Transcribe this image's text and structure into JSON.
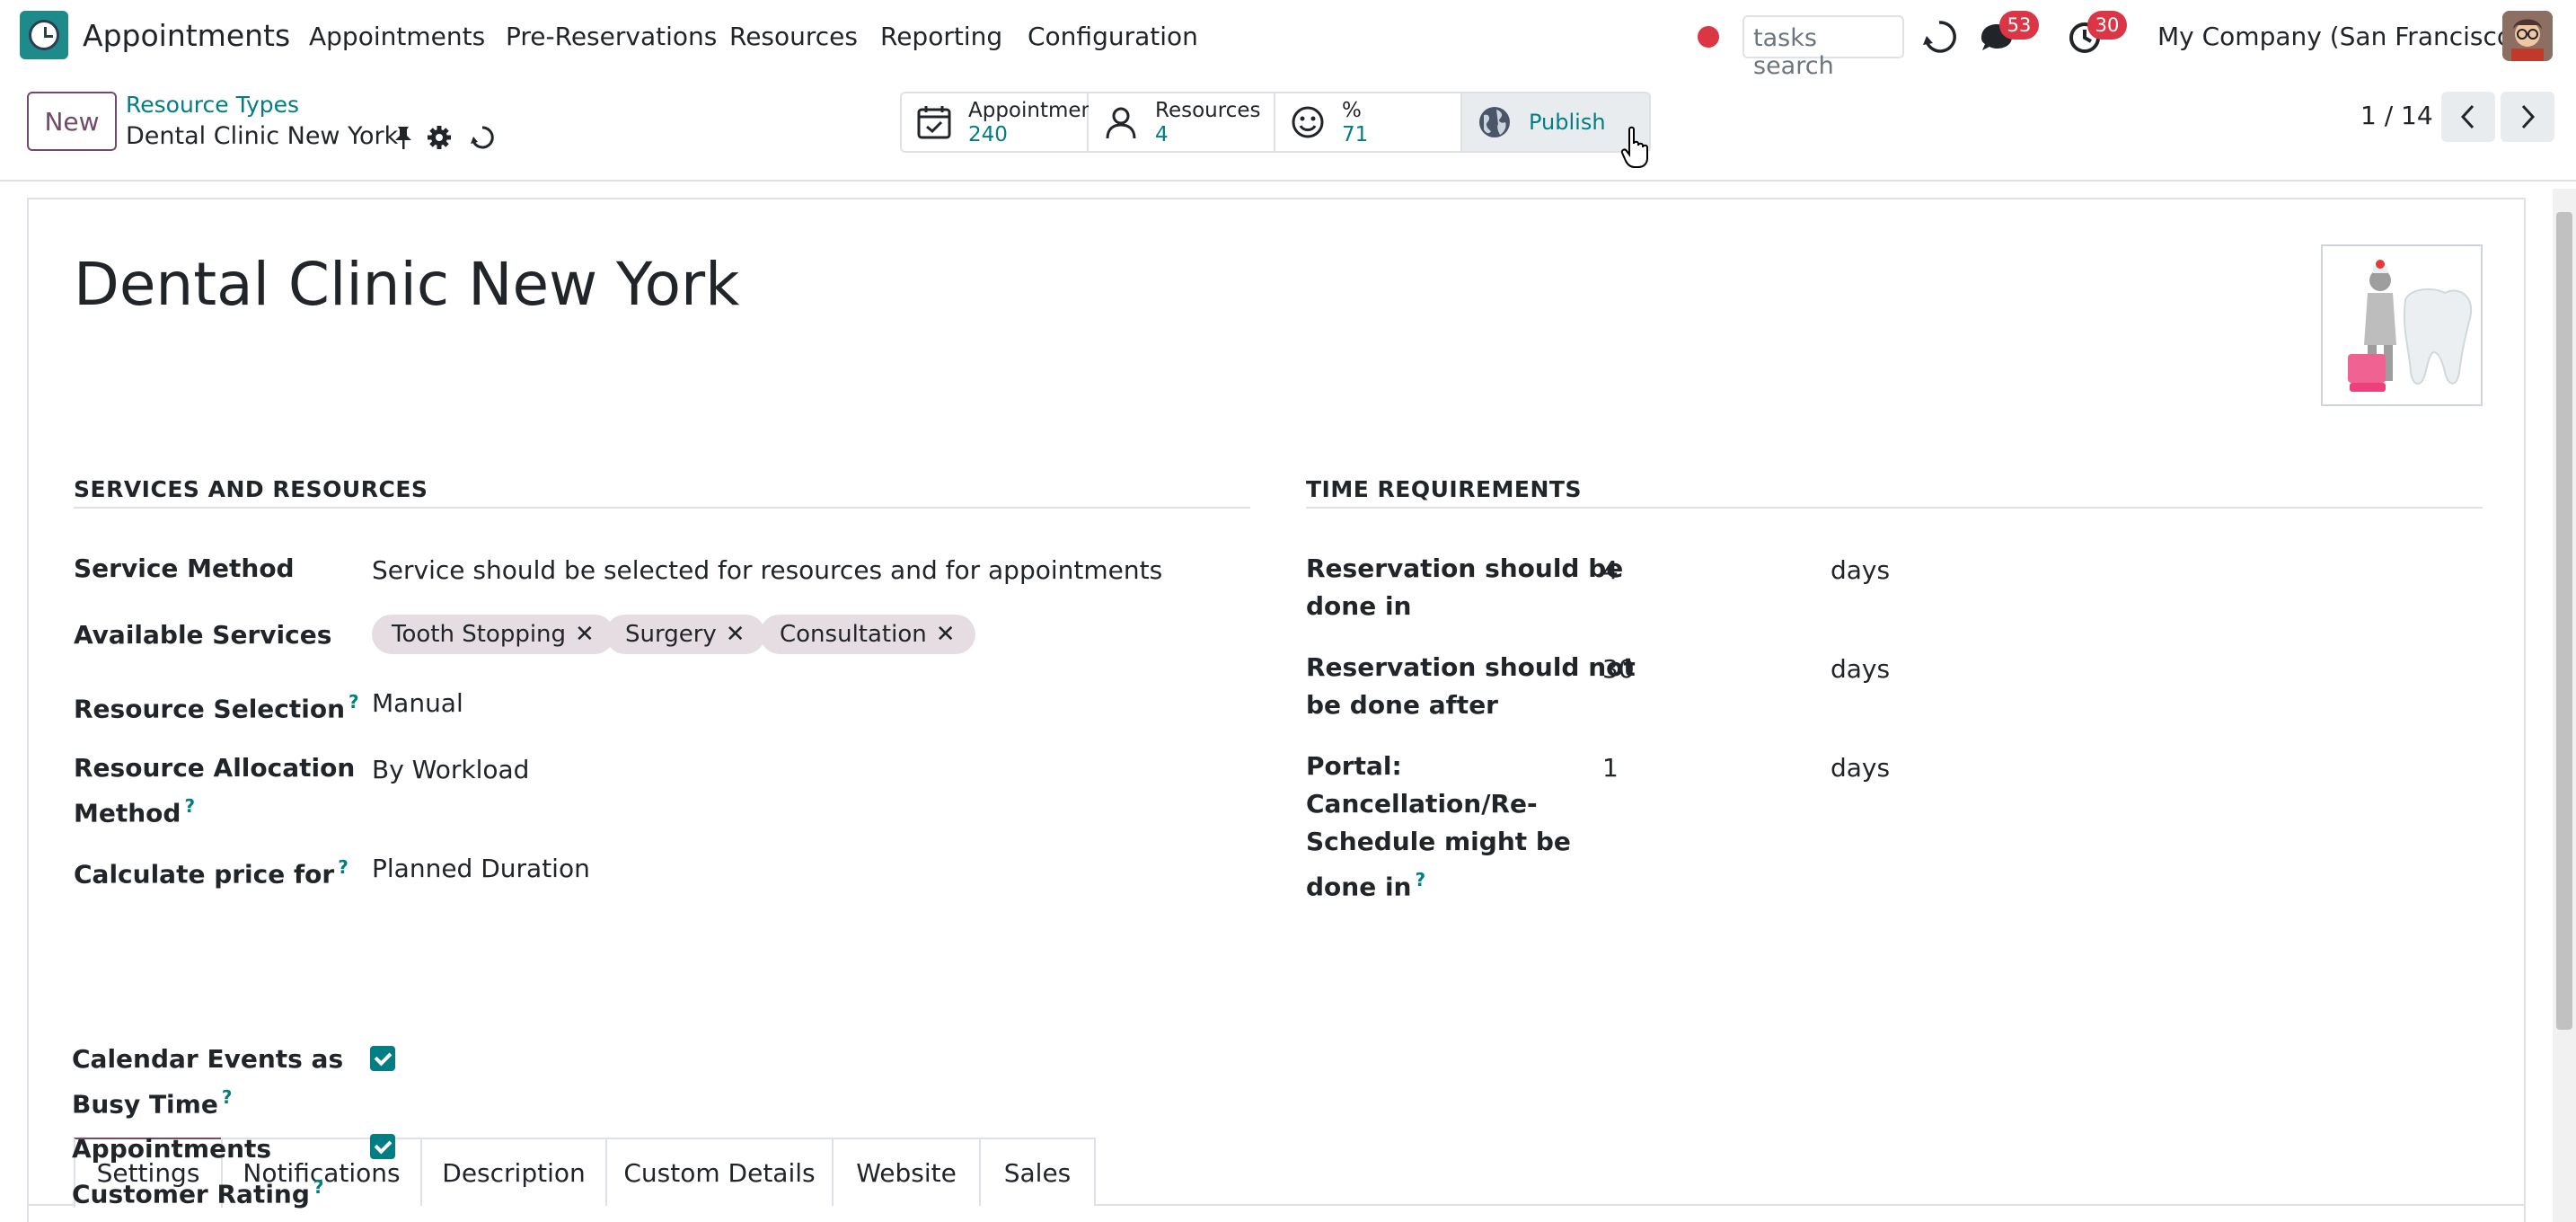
{
  "navbar": {
    "app_title": "Appointments",
    "menu": [
      "Appointments",
      "Pre-Reservations",
      "Resources",
      "Reporting",
      "Configuration"
    ],
    "search_value": "tasks search",
    "messages_count": "53",
    "activities_count": "30",
    "company": "My Company (San Francisco)"
  },
  "control": {
    "new_label": "New",
    "breadcrumb": "Resource Types",
    "record_name": "Dental Clinic New York",
    "stats": [
      {
        "label": "Appointments",
        "value": "240",
        "icon": "calendar-check-icon"
      },
      {
        "label": "Resources",
        "value": "4",
        "icon": "user-icon"
      },
      {
        "label": "%",
        "value": "71",
        "icon": "smiley-icon"
      },
      {
        "label": "Publish",
        "value": "",
        "icon": "globe-icon"
      }
    ],
    "pager": "1 / 14"
  },
  "form": {
    "title": "Dental Clinic New York",
    "services_group": {
      "title": "SERVICES AND RESOURCES",
      "service_method_label": "Service Method",
      "service_method_value": "Service should be selected for resources and for appointments",
      "available_services_label": "Available Services",
      "services": [
        "Tooth Stopping",
        "Surgery",
        "Consultation"
      ],
      "resource_selection_label": "Resource Selection",
      "resource_selection_value": "Manual",
      "allocation_label_1": "Resource Allocation",
      "allocation_label_2": "Method",
      "allocation_value": "By Workload",
      "price_label": "Calculate price for",
      "price_value": "Planned Duration"
    },
    "time_group": {
      "title": "TIME REQUIREMENTS",
      "rows": [
        {
          "label_lines": [
            "Reservation should be",
            "done in"
          ],
          "value": "4",
          "unit": "days"
        },
        {
          "label_lines": [
            "Reservation should not",
            "be done after"
          ],
          "value": "30",
          "unit": "days"
        },
        {
          "label_lines": [
            "Portal:",
            "Cancellation/Re-",
            "Schedule might be",
            "done in"
          ],
          "value": "1",
          "unit": "days"
        }
      ]
    },
    "tabs": [
      "Settings",
      "Notifications",
      "Description",
      "Custom Details",
      "Website",
      "Sales"
    ],
    "settings": {
      "busy_label_1": "Calendar Events as",
      "busy_label_2": "Busy Time",
      "rating_label_1": "Appointments",
      "rating_label_2": "Customer Rating"
    },
    "help_mark": "?"
  },
  "colors": {
    "brand": "#714b67",
    "link": "#017e84",
    "badge": "#dc3545"
  }
}
